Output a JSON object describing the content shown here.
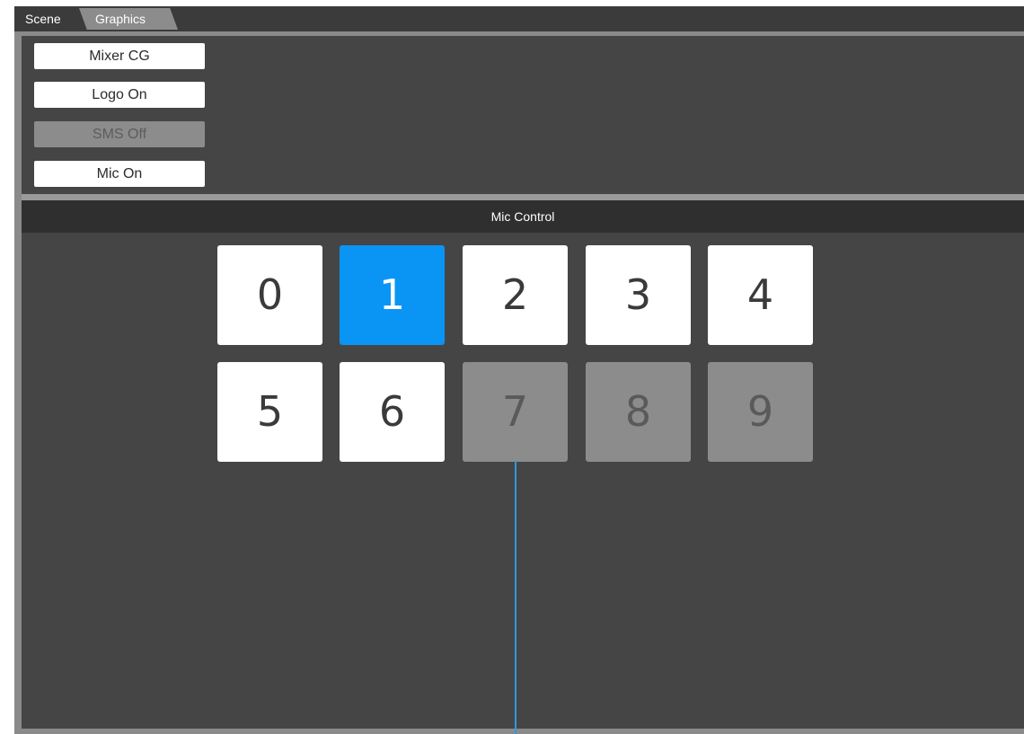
{
  "tabs": [
    {
      "label": "Scene",
      "active": false
    },
    {
      "label": "Graphics",
      "active": true
    }
  ],
  "graphics_buttons": [
    {
      "label": "Mixer CG",
      "state": "on"
    },
    {
      "label": "Logo On",
      "state": "on"
    },
    {
      "label": "SMS Off",
      "state": "off"
    },
    {
      "label": "Mic On",
      "state": "on"
    }
  ],
  "mic_control": {
    "title": "Mic Control",
    "buttons": [
      {
        "label": "0",
        "state": "on"
      },
      {
        "label": "1",
        "state": "active"
      },
      {
        "label": "2",
        "state": "on"
      },
      {
        "label": "3",
        "state": "on"
      },
      {
        "label": "4",
        "state": "on"
      },
      {
        "label": "5",
        "state": "on"
      },
      {
        "label": "6",
        "state": "on"
      },
      {
        "label": "7",
        "state": "off"
      },
      {
        "label": "8",
        "state": "off"
      },
      {
        "label": "9",
        "state": "off"
      }
    ]
  },
  "colors": {
    "active_accent": "#0a95f5",
    "panel_bg": "#454545",
    "header_bg": "#2f2f2f",
    "button_on": "#ffffff",
    "button_off": "#8c8c8c"
  }
}
